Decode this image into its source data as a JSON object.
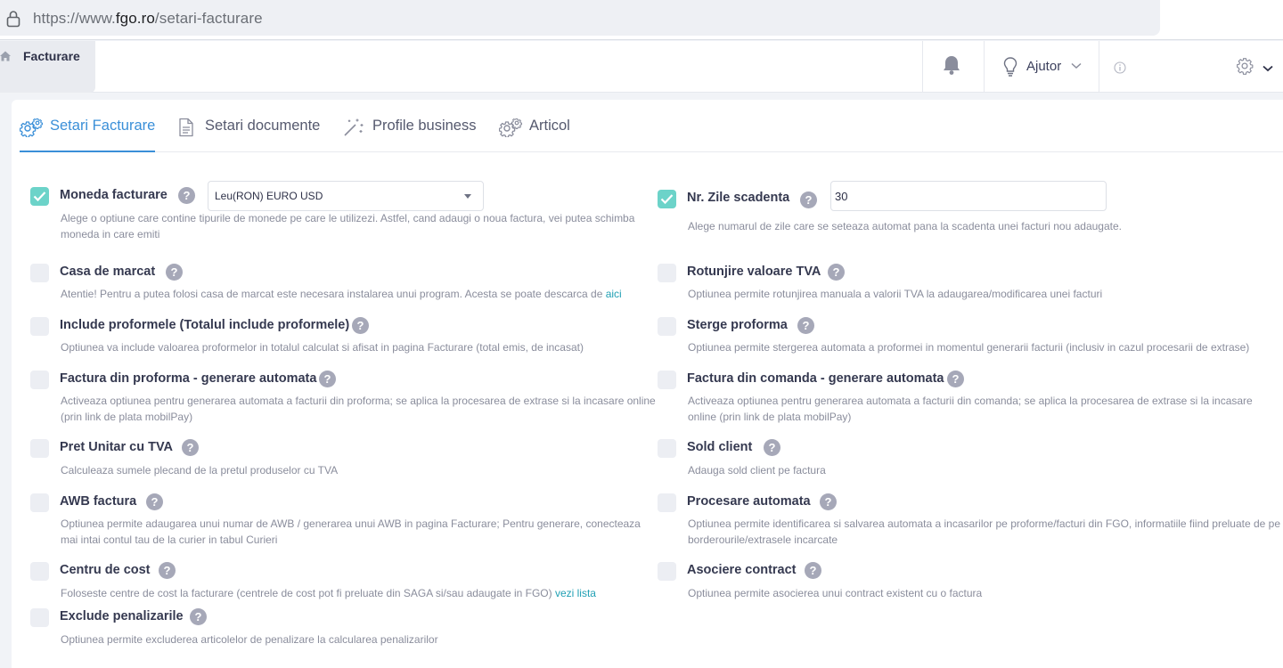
{
  "browser": {
    "url_prefix": "https://www.",
    "url_host": "fgo.ro",
    "url_path": "/setari-facturare"
  },
  "header": {
    "app_title": "Facturare",
    "help_label": "Ajutor"
  },
  "tabs": [
    {
      "label": "Setari Facturare",
      "icon": "gears-icon",
      "active": true
    },
    {
      "label": "Setari documente",
      "icon": "document-icon",
      "active": false
    },
    {
      "label": "Profile business",
      "icon": "magic-wand-icon",
      "active": false
    },
    {
      "label": "Articol",
      "icon": "gears-icon",
      "active": false
    }
  ],
  "settings": {
    "moneda": {
      "title": "Moneda facturare",
      "checked": true,
      "select_value": "Leu(RON) EURO USD",
      "desc": "Alege o optiune care contine tipurile de monede pe care le utilizezi. Astfel, cand adaugi o noua factura, vei putea schimba moneda in care emiti"
    },
    "zile": {
      "title": "Nr. Zile scadenta",
      "checked": true,
      "input_value": "30",
      "desc": "Alege numarul de zile care se seteaza automat pana la scadenta unei facturi nou adaugate."
    },
    "casa": {
      "title": "Casa de marcat",
      "checked": false,
      "desc": "Atentie! Pentru a putea folosi casa de marcat este necesara instalarea unui program. Acesta se poate descarca de",
      "link": "aici"
    },
    "rotunjire": {
      "title": "Rotunjire valoare TVA",
      "checked": false,
      "desc": "Optiunea permite rotunjirea manuala a valorii TVA la adaugarea/modificarea unei facturi"
    },
    "include": {
      "title": "Include proformele (Totalul include proformele)",
      "checked": false,
      "desc": "Optiunea va include valoarea proformelor in totalul calculat si afisat in pagina Facturare (total emis, de incasat)"
    },
    "sterge": {
      "title": "Sterge proforma",
      "checked": false,
      "desc": "Optiunea permite stergerea automata a proformei in momentul generarii facturii (inclusiv in cazul procesarii de extrase)"
    },
    "din_proforma": {
      "title": "Factura din proforma - generare automata",
      "checked": false,
      "desc": "Activeaza optiunea pentru generarea automata a facturii din proforma; se aplica la procesarea de extrase si la incasare online (prin link de plata mobilPay)"
    },
    "din_comanda": {
      "title": "Factura din comanda - generare automata",
      "checked": false,
      "desc": "Activeaza optiunea pentru generarea automata a facturii din comanda; se aplica la procesarea de extrase si la incasare online (prin link de plata mobilPay)"
    },
    "pret": {
      "title": "Pret Unitar cu TVA",
      "checked": false,
      "desc": "Calculeaza sumele plecand de la pretul produselor cu TVA"
    },
    "sold": {
      "title": "Sold client",
      "checked": false,
      "desc": "Adauga sold client pe factura"
    },
    "awb": {
      "title": "AWB factura",
      "checked": false,
      "desc": "Optiunea permite adaugarea unui numar de AWB / generarea unui AWB in pagina Facturare; Pentru generare, conecteaza mai intai contul tau de la curier in tabul Curieri"
    },
    "procesare": {
      "title": "Procesare automata",
      "checked": false,
      "desc": "Optiunea permite identificarea si salvarea automata a incasarilor pe proforme/facturi din FGO, informatiile fiind preluate de pe borderourile/extrasele incarcate"
    },
    "centru": {
      "title": "Centru de cost",
      "checked": false,
      "desc": "Foloseste centre de cost la facturare (centrele de cost pot fi preluate din SAGA si/sau adaugate in FGO)",
      "link": "vezi lista"
    },
    "asociere": {
      "title": "Asociere contract",
      "checked": false,
      "desc": "Optiunea permite asocierea unui contract existent cu o factura"
    },
    "exclude": {
      "title": "Exclude penalizarile",
      "checked": false,
      "desc": "Optiunea permite excluderea articolelor de penalizare la calcularea penalizarilor"
    }
  },
  "colors": {
    "accent": "#3a8fd8",
    "checked": "#6cd3c9",
    "link": "#21a0b4",
    "help_badge": "#a6a8b8"
  }
}
